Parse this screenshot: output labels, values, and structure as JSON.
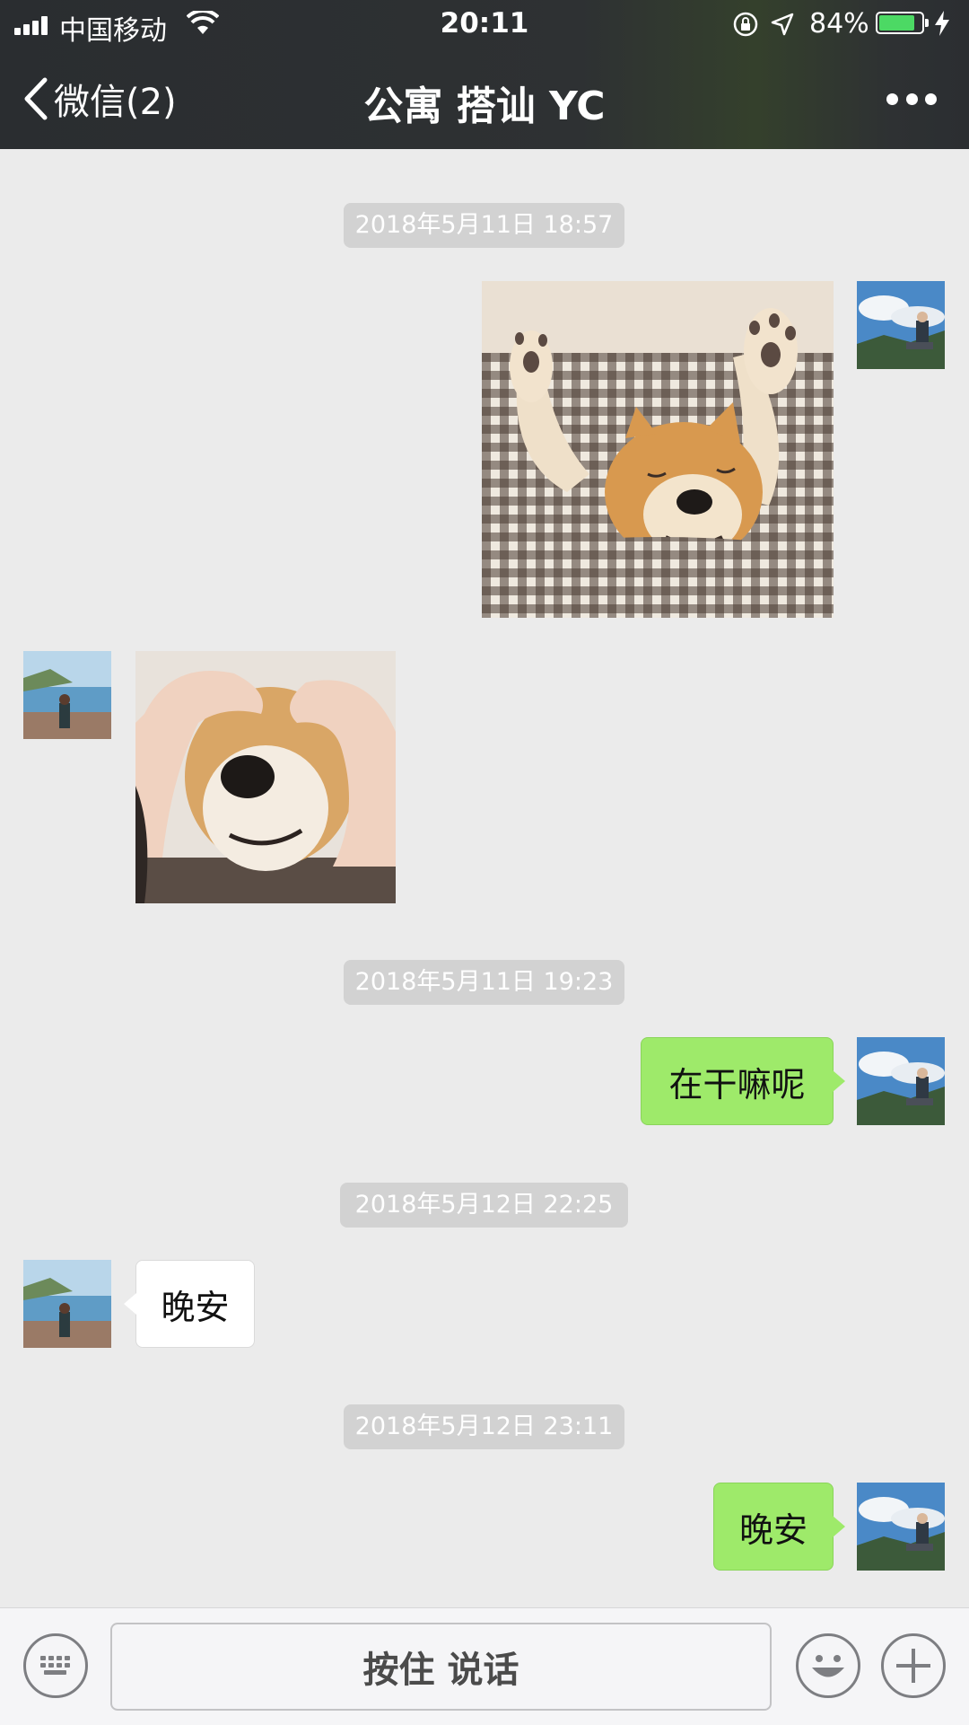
{
  "status_bar": {
    "carrier": "中国移动",
    "time": "20:11",
    "battery_percent": "84%",
    "battery_level": 0.84,
    "icons": [
      "signal-bars-icon",
      "wifi-icon",
      "orientation-lock-icon",
      "location-arrow-icon",
      "battery-icon",
      "charging-bolt-icon"
    ]
  },
  "nav": {
    "back_label": "微信(2)",
    "title": "公寓 搭讪 YC",
    "more_icon": "more-dots-icon"
  },
  "messages": [
    {
      "type": "timestamp",
      "text": "2018年5月11日 18:57"
    },
    {
      "type": "image",
      "sender": "me",
      "content": "shiba dog lying in gingham blanket with paws up"
    },
    {
      "type": "image",
      "sender": "other",
      "content": "hands holding shiba dog face"
    },
    {
      "type": "timestamp",
      "text": "2018年5月11日 19:23"
    },
    {
      "type": "text",
      "sender": "me",
      "text": "在干嘛呢"
    },
    {
      "type": "timestamp",
      "text": "2018年5月12日 22:25"
    },
    {
      "type": "text",
      "sender": "other",
      "text": "晚安"
    },
    {
      "type": "timestamp",
      "text": "2018年5月12日 23:11"
    },
    {
      "type": "text",
      "sender": "me",
      "text": "晚安"
    }
  ],
  "input_bar": {
    "hold_to_talk_label": "按住 说话",
    "icons": [
      "keyboard-icon",
      "emoji-icon",
      "plus-icon"
    ]
  },
  "colors": {
    "sent_bubble": "#9eea6a",
    "received_bubble": "#ffffff",
    "chat_background": "#ebebeb",
    "top_bar": "#2e3133"
  }
}
